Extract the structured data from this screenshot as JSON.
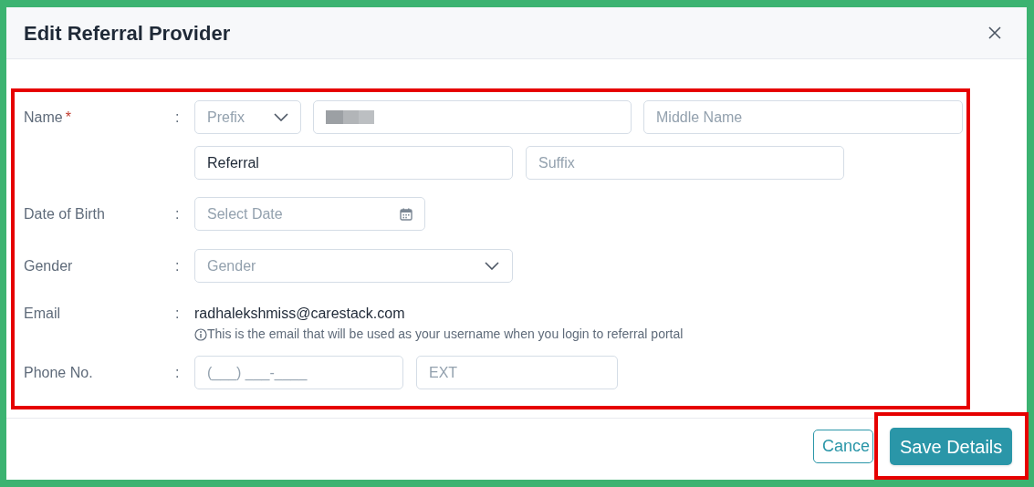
{
  "dialog": {
    "title": "Edit Referral Provider"
  },
  "fields": [
    {
      "kind": "name",
      "label": "Name",
      "required_mark": "*",
      "colon": ":",
      "inputs": [
        {
          "kind": "select",
          "placeholder": "Prefix"
        },
        {
          "kind": "redacted"
        },
        {
          "kind": "text",
          "placeholder": "Middle Name"
        },
        {
          "kind": "text",
          "value": "Referral"
        },
        {
          "kind": "text",
          "placeholder": "Suffix"
        }
      ]
    },
    {
      "kind": "date",
      "label": "Date of Birth",
      "colon": ":",
      "placeholder": "Select Date"
    },
    {
      "kind": "select",
      "label": "Gender",
      "colon": ":",
      "placeholder": "Gender"
    },
    {
      "kind": "email",
      "label": "Email",
      "colon": ":",
      "value": "radhalekshmiss@carestack.com",
      "hint": "This is the email that will be used as your username when you login to referral portal"
    },
    {
      "kind": "phone",
      "label": "Phone No.",
      "colon": ":",
      "placeholder": "(___) ___-____",
      "ext_placeholder": "EXT"
    }
  ],
  "buttons": [
    {
      "kind": "secondary",
      "label": "Cance"
    },
    {
      "kind": "primary",
      "label": "Save Details"
    }
  ]
}
